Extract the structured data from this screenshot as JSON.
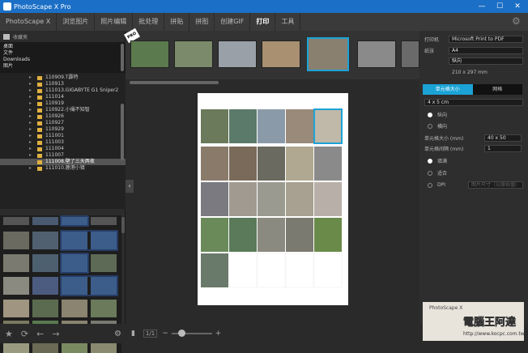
{
  "window": {
    "title": "PhotoScape X Pro",
    "controls": [
      "—",
      "☐",
      "✕"
    ]
  },
  "menu": {
    "items": [
      "PhotoScape X",
      "浏览图片",
      "照片编辑",
      "批处理",
      "拼贴",
      "拼图",
      "创建GIF",
      "打印",
      "工具"
    ],
    "active_index": 7
  },
  "favorites": {
    "header": "收藏夹",
    "items": [
      "桌面",
      "文件",
      "Downloads",
      "图片"
    ]
  },
  "folders": [
    {
      "label": "110909.T霹特"
    },
    {
      "label": "110913"
    },
    {
      "label": "111013.GIGABYTE G1 Sniper2"
    },
    {
      "label": "111014"
    },
    {
      "label": "110919"
    },
    {
      "label": "110922.小撮不知智"
    },
    {
      "label": "110926"
    },
    {
      "label": "110927"
    },
    {
      "label": "110929"
    },
    {
      "label": "111001"
    },
    {
      "label": "111003"
    },
    {
      "label": "111004"
    },
    {
      "label": "111007"
    },
    {
      "label": "111008.壁了三天两夜"
    },
    {
      "label": "111010.鹿港小镇"
    }
  ],
  "selected_folder_index": 13,
  "left_toolbar": {
    "icons": [
      "star-icon",
      "refresh-icon",
      "back-icon",
      "forward-icon"
    ]
  },
  "right_panel": {
    "printer_label": "打印机",
    "printer_value": "Microsoft Print to PDF",
    "paper_label": "纸张",
    "paper_value": "A4",
    "orientation_value": "纵向",
    "paper_size_text": "210 x 297 mm",
    "tabs": [
      "单元格大小",
      "网格"
    ],
    "active_tab": 0,
    "cell_size_value": "4 x 5 cm",
    "orient_options": [
      "纵向",
      "横向"
    ],
    "orient_selected": 0,
    "cell_size_label": "单元格大小 (mm)",
    "cell_size_input": "40 x 50",
    "cell_spacing_label": "单元格间隔 (mm)",
    "cell_spacing_input": "1",
    "fit_options": [
      "填满",
      "适合",
      "DPI"
    ],
    "fit_selected": 0,
    "dpi_placeholder": "图片尺寸（以原始值）"
  },
  "bottom_bar": {
    "page_label": "1/1"
  },
  "watermark": {
    "brand": "電腦王阿達",
    "url": "http://www.kocpc.com.tw"
  },
  "colors": {
    "accent": "#1ba3d6",
    "titlebar": "#1b6fc6"
  }
}
